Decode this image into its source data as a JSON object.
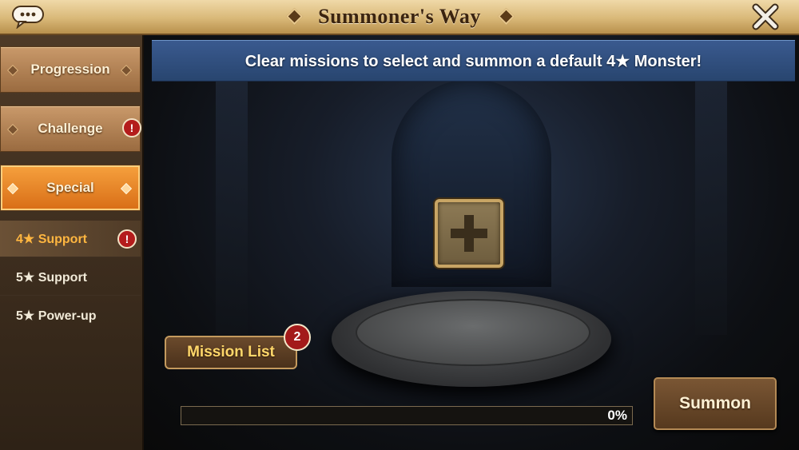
{
  "header": {
    "title": "Summoner's Way",
    "chat_icon": "chat-bubble-icon",
    "close_icon": "close-icon"
  },
  "sidebar": {
    "categories": [
      {
        "label": "Progression",
        "active": false,
        "alert": false
      },
      {
        "label": "Challenge",
        "active": false,
        "alert": true
      },
      {
        "label": "Special",
        "active": true,
        "alert": false
      }
    ],
    "sub_items": [
      {
        "label": "4★ Support",
        "active": true,
        "alert": true
      },
      {
        "label": "5★ Support",
        "active": false,
        "alert": false
      },
      {
        "label": "5★ Power-up",
        "active": false,
        "alert": false
      }
    ],
    "alert_glyph": "!"
  },
  "main": {
    "banner": "Clear missions to select and summon a default 4★ Monster!",
    "add_slot_icon": "plus-icon",
    "mission_list": {
      "label": "Mission List",
      "badge": "2"
    },
    "progress": {
      "text": "0%",
      "value": 0
    },
    "summon_label": "Summon"
  },
  "colors": {
    "active_tab": "#e88a25",
    "active_sub_text": "#ffb640",
    "banner_blue": "#2f4f80",
    "alert_red": "#b41c1c"
  }
}
